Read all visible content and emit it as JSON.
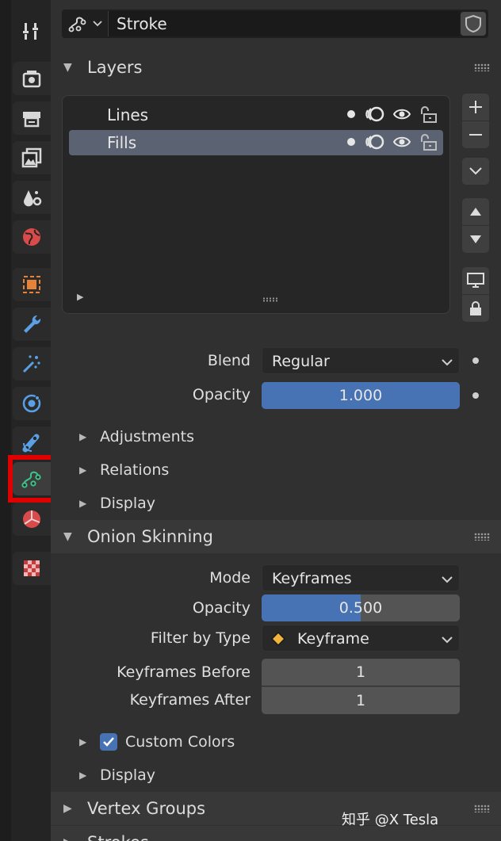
{
  "tabs": [
    {
      "name": "tool-tab",
      "icon": "tool-icon"
    },
    {
      "name": "render-tab",
      "icon": "render-icon"
    },
    {
      "name": "output-tab",
      "icon": "output-icon"
    },
    {
      "name": "view-layer-tab",
      "icon": "view-layer-icon"
    },
    {
      "name": "scene-tab",
      "icon": "scene-icon"
    },
    {
      "name": "world-tab",
      "icon": "world-icon"
    },
    {
      "name": "object-tab",
      "icon": "object-icon"
    },
    {
      "name": "modifiers-tab",
      "icon": "wrench-icon"
    },
    {
      "name": "effects-tab",
      "icon": "shader-fx-icon"
    },
    {
      "name": "physics-tab",
      "icon": "physics-icon"
    },
    {
      "name": "constraints-tab",
      "icon": "constraint-icon"
    },
    {
      "name": "object-data-tab",
      "icon": "grease-pencil-data-icon",
      "active": true
    },
    {
      "name": "material-tab",
      "icon": "material-icon"
    },
    {
      "name": "texture-tab",
      "icon": "texture-icon"
    }
  ],
  "header": {
    "datablock_name": "Stroke"
  },
  "layers_panel": {
    "title": "Layers",
    "layers": [
      {
        "name": "Lines",
        "selected": false
      },
      {
        "name": "Fills",
        "selected": true
      }
    ],
    "blend_label": "Blend",
    "blend_value": "Regular",
    "opacity_label": "Opacity",
    "opacity_value": "1.000",
    "opacity_fraction": 1.0,
    "subpanels": [
      "Adjustments",
      "Relations",
      "Display"
    ]
  },
  "onion_panel": {
    "title": "Onion Skinning",
    "mode_label": "Mode",
    "mode_value": "Keyframes",
    "opacity_label": "Opacity",
    "opacity_value": "0.500",
    "opacity_fraction": 0.5,
    "filter_label": "Filter by Type",
    "filter_value": "Keyframe",
    "kf_before_label": "Keyframes Before",
    "kf_before_value": "1",
    "kf_after_label": "Keyframes After",
    "kf_after_value": "1",
    "custom_colors_label": "Custom Colors",
    "custom_colors_checked": true,
    "display_label": "Display"
  },
  "collapsed_panels": [
    "Vertex Groups",
    "Strokes"
  ],
  "watermark": "知乎 @X Tesla",
  "colors": {
    "accent_blue": "#4772b3",
    "selected_row": "#5b6272",
    "highlight_red": "#e00000",
    "grease_pencil_green": "#3cc48a",
    "keyframe_orange": "#f0b43a"
  }
}
